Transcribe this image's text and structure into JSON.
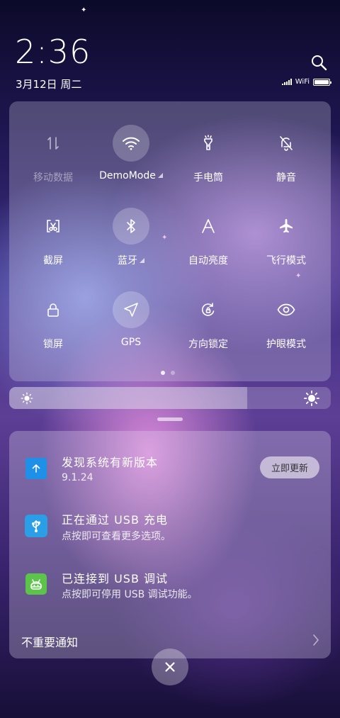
{
  "lockscreen": {
    "time": "2:36",
    "date": "3月12日 周二"
  },
  "status_bar": {
    "wifi_label": "WiFi"
  },
  "quick_settings": {
    "tiles": [
      {
        "label": "移动数据",
        "icon": "mobile-data-icon",
        "active": false,
        "dimmed": true,
        "has_menu": false
      },
      {
        "label": "DemoMode",
        "icon": "wifi-icon",
        "active": true,
        "dimmed": false,
        "has_menu": true
      },
      {
        "label": "手电筒",
        "icon": "flashlight-icon",
        "active": false,
        "dimmed": false,
        "has_menu": false
      },
      {
        "label": "静音",
        "icon": "mute-bell-icon",
        "active": false,
        "dimmed": false,
        "has_menu": false
      },
      {
        "label": "截屏",
        "icon": "screenshot-icon",
        "active": false,
        "dimmed": false,
        "has_menu": false
      },
      {
        "label": "蓝牙",
        "icon": "bluetooth-icon",
        "active": true,
        "dimmed": false,
        "has_menu": true
      },
      {
        "label": "自动亮度",
        "icon": "auto-brightness-icon",
        "active": false,
        "dimmed": false,
        "has_menu": false
      },
      {
        "label": "飞行模式",
        "icon": "airplane-icon",
        "active": false,
        "dimmed": false,
        "has_menu": false
      },
      {
        "label": "锁屏",
        "icon": "lock-icon",
        "active": false,
        "dimmed": false,
        "has_menu": false
      },
      {
        "label": "GPS",
        "icon": "gps-icon",
        "active": true,
        "dimmed": false,
        "has_menu": false
      },
      {
        "label": "方向锁定",
        "icon": "rotation-lock-icon",
        "active": false,
        "dimmed": false,
        "has_menu": false
      },
      {
        "label": "护眼模式",
        "icon": "eye-icon",
        "active": false,
        "dimmed": false,
        "has_menu": false
      }
    ],
    "page_count": 2,
    "current_page": 1
  },
  "brightness": {
    "level": 0.74
  },
  "notifications": {
    "items": [
      {
        "title": "发现系统有新版本",
        "subtitle": "9.1.24",
        "icon": "update-arrow-icon",
        "icon_color": "#1e90e8",
        "action": "立即更新"
      },
      {
        "title": "正在通过 USB 充电",
        "subtitle": "点按即可查看更多选项。",
        "icon": "usb-icon",
        "icon_color": "#2a9ee6"
      },
      {
        "title": "已连接到 USB 调试",
        "subtitle": "点按即可停用 USB 调试功能。",
        "icon": "android-debug-icon",
        "icon_color": "#5cc44a"
      }
    ],
    "unimportant_label": "不重要通知"
  },
  "colors": {
    "accent": "#1e90e8",
    "usb": "#2a9ee6",
    "android": "#5cc44a"
  }
}
